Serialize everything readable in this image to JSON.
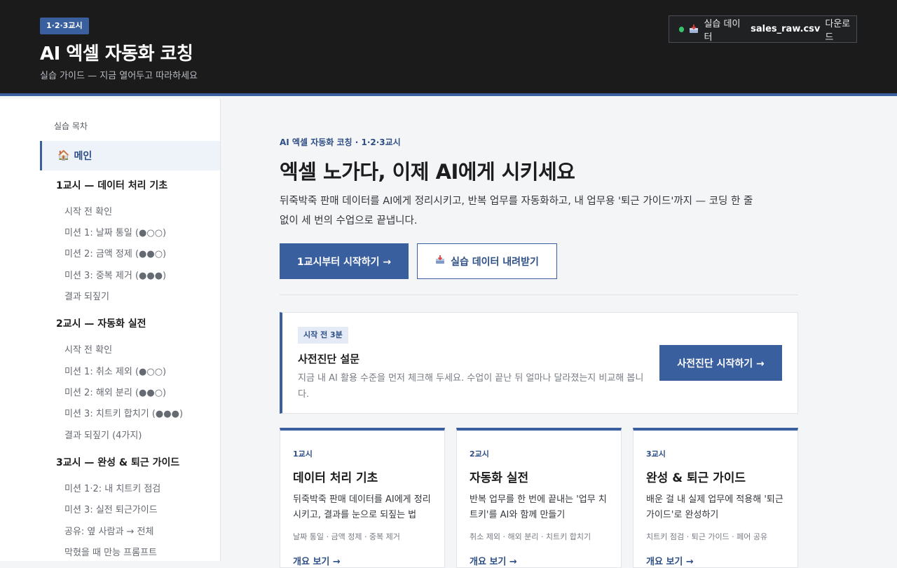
{
  "header": {
    "session_badge": "1·2·3교시",
    "title": "AI 엑셀 자동화 코칭",
    "subtitle": "실습 가이드 — 지금 열어두고 따라하세요",
    "download": {
      "prefix": "실습 데이터",
      "file": "sales_raw.csv",
      "suffix": "다운로드"
    }
  },
  "sidebar": {
    "toc_title": "실습 목차",
    "home": "메인",
    "groups": [
      {
        "label": "1교시 — 데이터 처리 기초",
        "items": [
          "시작 전 확인",
          "미션 1: 날짜 통일 (●○○)",
          "미션 2: 금액 정제 (●●○)",
          "미션 3: 중복 제거 (●●●)",
          "결과 되짚기"
        ]
      },
      {
        "label": "2교시 — 자동화 실전",
        "items": [
          "시작 전 확인",
          "미션 1: 취소 제외 (●○○)",
          "미션 2: 해외 분리 (●●○)",
          "미션 3: 치트키 합치기 (●●●)",
          "결과 되짚기 (4가지)"
        ]
      },
      {
        "label": "3교시 — 완성 & 퇴근 가이드",
        "items": [
          "미션 1·2: 내 치트키 점검",
          "미션 3: 실전 퇴근가이드",
          "공유: 옆 사람과 → 전체",
          "막혔을 때 만능 프롬프트"
        ]
      }
    ]
  },
  "hero": {
    "eyebrow": "AI 엑셀 자동화 코칭 · 1·2·3교시",
    "title": "엑셀 노가다, 이제 AI에게 시키세요",
    "desc": "뒤죽박죽 판매 데이터를 AI에게 정리시키고, 반복 업무를 자동화하고, 내 업무용 '퇴근 가이드'까지 — 코딩 한 줄 없이 세 번의 수업으로 끝냅니다.",
    "primary_btn": "1교시부터 시작하기 →",
    "outline_btn": "실습 데이터 내려받기"
  },
  "survey": {
    "tag": "시작 전 3분",
    "title": "사전진단 설문",
    "desc": "지금 내 AI 활용 수준을 먼저 체크해 두세요. 수업이 끝난 뒤 얼마나 달라졌는지 비교해 봅니다.",
    "button": "사전진단 시작하기 →"
  },
  "cards": [
    {
      "kicker": "1교시",
      "title": "데이터 처리 기초",
      "desc": "뒤죽박죽 판매 데이터를 AI에게 정리시키고, 결과를 눈으로 되짚는 법",
      "tags": "날짜 통일 · 금액 정제 · 중복 제거",
      "link": "개요 보기 →"
    },
    {
      "kicker": "2교시",
      "title": "자동화 실전",
      "desc": "반복 업무를 한 번에 끝내는 '업무 치트키'를 AI와 함께 만들기",
      "tags": "취소 제외 · 해외 분리 · 치트키 합치기",
      "link": "개요 보기 →"
    },
    {
      "kicker": "3교시",
      "title": "완성 & 퇴근 가이드",
      "desc": "배운 걸 내 실제 업무에 적용해 '퇴근 가이드'로 완성하기",
      "tags": "치트키 점검 · 퇴근 가이드 · 페어 공유",
      "link": "개요 보기 →"
    }
  ]
}
